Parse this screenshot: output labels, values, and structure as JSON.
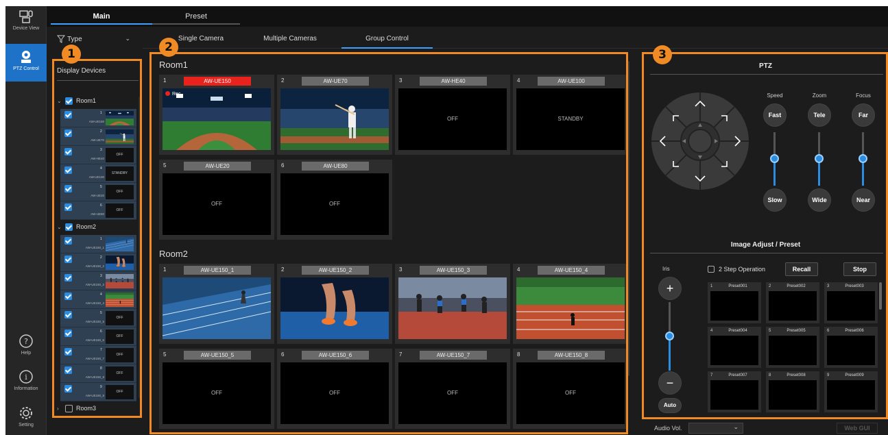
{
  "nav": {
    "device_view": "Device View",
    "ptz_control": "PTZ Control",
    "help": "Help",
    "information": "Information",
    "setting": "Setting"
  },
  "tabs": {
    "main": "Main",
    "preset": "Preset"
  },
  "filter": {
    "label": "Type"
  },
  "subtabs": {
    "single": "Single Camera",
    "multiple": "Multiple Cameras",
    "group": "Group Control"
  },
  "callouts": {
    "one": "1",
    "two": "2",
    "three": "3"
  },
  "device_panel": {
    "title": "Display Devices",
    "rooms": [
      {
        "name": "Room1",
        "checked": true,
        "expanded": true,
        "devices": [
          {
            "num": "1",
            "name": "AW-UE150",
            "thumb": ""
          },
          {
            "num": "2",
            "name": "AW-UE70",
            "thumb": ""
          },
          {
            "num": "3",
            "name": "AW-HE40",
            "thumb": "OFF"
          },
          {
            "num": "4",
            "name": "AW-UE100",
            "thumb": "STANDBY"
          },
          {
            "num": "5",
            "name": "AW-UE20",
            "thumb": "OFF"
          },
          {
            "num": "6",
            "name": "AW-UE80",
            "thumb": "OFF"
          }
        ]
      },
      {
        "name": "Room2",
        "checked": true,
        "expanded": true,
        "devices": [
          {
            "num": "1",
            "name": "AW-UE150_1",
            "thumb": ""
          },
          {
            "num": "2",
            "name": "AW-UE150_2",
            "thumb": ""
          },
          {
            "num": "3",
            "name": "AW-UE150_3",
            "thumb": ""
          },
          {
            "num": "4",
            "name": "AW-UE150_4",
            "thumb": ""
          },
          {
            "num": "5",
            "name": "AW-UE150_5",
            "thumb": "OFF"
          },
          {
            "num": "6",
            "name": "AW-UE150_6",
            "thumb": "OFF"
          },
          {
            "num": "7",
            "name": "AW-UE150_7",
            "thumb": "OFF"
          },
          {
            "num": "8",
            "name": "AW-UE150_8",
            "thumb": "OFF"
          },
          {
            "num": "9",
            "name": "AW-UE150_9",
            "thumb": "OFF"
          }
        ]
      },
      {
        "name": "Room3",
        "checked": false,
        "expanded": false,
        "devices": []
      }
    ]
  },
  "grid": {
    "rooms": [
      {
        "title": "Room1",
        "cameras": [
          {
            "num": "1",
            "name": "AW-UE150",
            "status": "",
            "tally": true,
            "rec": "Rec",
            "scene": "stadium"
          },
          {
            "num": "2",
            "name": "AW-UE70",
            "status": "",
            "tally": false,
            "scene": "batter"
          },
          {
            "num": "3",
            "name": "AW-HE40",
            "status": "OFF",
            "tally": false
          },
          {
            "num": "4",
            "name": "AW-UE100",
            "status": "STANDBY",
            "tally": false
          },
          {
            "num": "5",
            "name": "AW-UE20",
            "status": "OFF",
            "tally": false
          },
          {
            "num": "6",
            "name": "AW-UE80",
            "status": "OFF",
            "tally": false
          }
        ]
      },
      {
        "title": "Room2",
        "cameras": [
          {
            "num": "1",
            "name": "AW-UE150_1",
            "status": "",
            "tally": false,
            "scene": "track-runner"
          },
          {
            "num": "2",
            "name": "AW-UE150_2",
            "status": "",
            "tally": false,
            "scene": "start-block"
          },
          {
            "num": "3",
            "name": "AW-UE150_3",
            "status": "",
            "tally": false,
            "scene": "sprinters"
          },
          {
            "num": "4",
            "name": "AW-UE150_4",
            "status": "",
            "tally": false,
            "scene": "stadium-track"
          },
          {
            "num": "5",
            "name": "AW-UE150_5",
            "status": "OFF",
            "tally": false
          },
          {
            "num": "6",
            "name": "AW-UE150_6",
            "status": "OFF",
            "tally": false
          },
          {
            "num": "7",
            "name": "AW-UE150_7",
            "status": "OFF",
            "tally": false
          },
          {
            "num": "8",
            "name": "AW-UE150_8",
            "status": "OFF",
            "tally": false
          }
        ]
      }
    ]
  },
  "ptz": {
    "title": "PTZ",
    "speed": {
      "label": "Speed",
      "top": "Fast",
      "bottom": "Slow",
      "level": 0.5
    },
    "zoom": {
      "label": "Zoom",
      "top": "Tele",
      "bottom": "Wide",
      "level": 0.5
    },
    "focus": {
      "label": "Focus",
      "top": "Far",
      "bottom": "Near",
      "level": 0.5
    }
  },
  "image_adjust": {
    "title": "Image Adjust / Preset",
    "iris_label": "Iris",
    "iris_auto": "Auto",
    "iris_level": 0.5,
    "two_step": "2 Step Operation",
    "recall": "Recall",
    "stop": "Stop",
    "presets": [
      {
        "num": "1",
        "name": "Preset001"
      },
      {
        "num": "2",
        "name": "Preset002"
      },
      {
        "num": "3",
        "name": "Preset003"
      },
      {
        "num": "4",
        "name": "Preset004"
      },
      {
        "num": "5",
        "name": "Preset005"
      },
      {
        "num": "6",
        "name": "Preset006"
      },
      {
        "num": "7",
        "name": "Preset007"
      },
      {
        "num": "8",
        "name": "Preset008"
      },
      {
        "num": "9",
        "name": "Preset009"
      }
    ]
  },
  "bottom": {
    "audio_vol": "Audio Vol.",
    "web_gui": "Web GUI"
  },
  "colors": {
    "accent": "#2a8de0",
    "tally": "#e8231e",
    "callout": "#f08a24",
    "nav_active": "#1e73c8"
  }
}
